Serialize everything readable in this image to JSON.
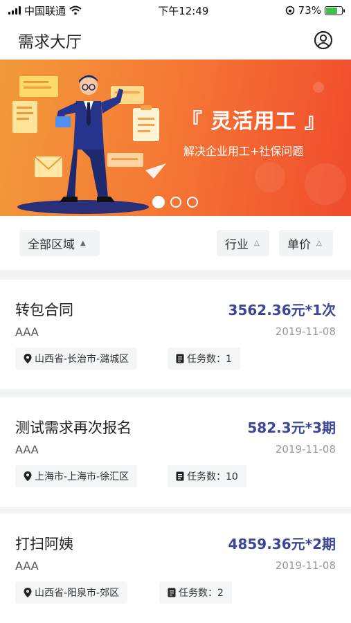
{
  "status_bar": {
    "carrier": "中国联通",
    "time": "下午12:49",
    "battery_percent": "73%",
    "battery_level": 0.73
  },
  "header": {
    "title": "需求大厅",
    "user_icon": "user-circle-icon"
  },
  "banner": {
    "title": "『 灵活用工 』",
    "subtitle": "解决企业用工+社保问题",
    "slides": 3,
    "active_slide": 1
  },
  "filters": {
    "region": "全部区域",
    "industry": "行业",
    "price": "单价"
  },
  "cards": [
    {
      "title": "转包合同",
      "price": "3562.36元*1次",
      "org": "AAA",
      "date": "2019-11-08",
      "location": "山西省-长治市-潞城区",
      "tasks": "任务数：1"
    },
    {
      "title": "测试需求再次报名",
      "price": "582.3元*3期",
      "org": "AAA",
      "date": "2019-11-08",
      "location": "上海市-上海市-徐汇区",
      "tasks": "任务数：10"
    },
    {
      "title": "打扫阿姨",
      "price": "4859.36元*2期",
      "org": "AAA",
      "date": "2019-11-08",
      "location": "山西省-阳泉市-郊区",
      "tasks": "任务数：2"
    }
  ],
  "colors": {
    "accent": "#3b4699",
    "banner": "#f46a32"
  }
}
